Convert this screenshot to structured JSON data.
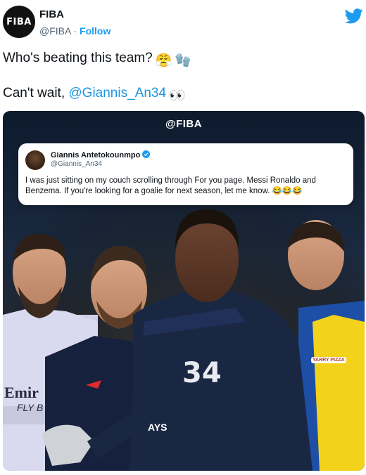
{
  "account": {
    "avatar_text": "FIBA",
    "name": "FIBA",
    "handle": "@FIBA",
    "separator": " · ",
    "follow_label": "Follow"
  },
  "tweet": {
    "line1_text": "Who's beating this team?",
    "line1_emojis": [
      "😤",
      "🧤"
    ],
    "line2_prefix": "Can't wait, ",
    "line2_mention": "@Giannis_An34",
    "line2_emoji": "👀"
  },
  "media": {
    "watermark": "@FIBA",
    "quoted": {
      "name": "Giannis Antetokounmpo",
      "handle": "@Giannis_An34",
      "text": "I was just sitting on my couch scrolling through For you page. Messi Ronaldo and Benzema.  If you're looking for a goalie for next season, let me know. 😂😂😂"
    },
    "jersey_number": "34",
    "shirt_text_left": "Emir",
    "shirt_text_left2": "FLY B",
    "shirt_text_right": "YARRY PIZZA",
    "shirt_text_center": "AYS"
  },
  "colors": {
    "twitter_blue": "#1d9bf0",
    "mention_blue": "#1b95e0",
    "verified_blue": "#1d9bf0"
  }
}
